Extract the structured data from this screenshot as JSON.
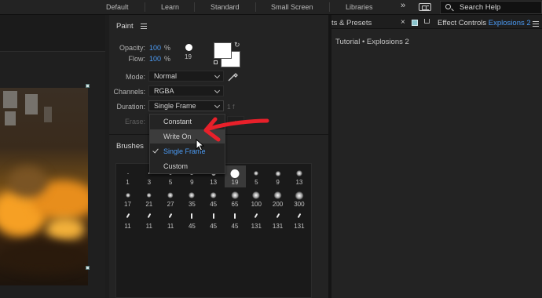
{
  "workspace_bar": {
    "tabs": [
      "Default",
      "Learn",
      "Standard",
      "Small Screen",
      "Libraries"
    ],
    "more_icon": "double-chevron-right",
    "search_placeholder": "Search Help"
  },
  "paint_panel": {
    "title": "Paint",
    "opacity_label": "Opacity:",
    "opacity_value": "100",
    "flow_label": "Flow:",
    "flow_value": "100",
    "percent": "%",
    "brush_size": "19",
    "mode_label": "Mode:",
    "mode_value": "Normal",
    "channels_label": "Channels:",
    "channels_value": "RGBA",
    "duration_label": "Duration:",
    "duration_value": "Single Frame",
    "duration_suffix": "1  f",
    "erase_label": "Erase:",
    "foreground_color": "#ffffff",
    "background_color": "#ffffff"
  },
  "duration_menu": {
    "items": [
      {
        "label": "Constant",
        "state": "normal"
      },
      {
        "label": "Write On",
        "state": "hover"
      },
      {
        "label": "Single Frame",
        "state": "selected"
      },
      {
        "label": "Custom",
        "state": "normal"
      }
    ]
  },
  "brushes_panel": {
    "title": "Brushes",
    "rows": [
      [
        "1",
        "3",
        "5",
        "9",
        "13",
        "19",
        "5",
        "9",
        "13"
      ],
      [
        "17",
        "21",
        "27",
        "35",
        "45",
        "65",
        "100",
        "200",
        "300"
      ],
      [
        "11",
        "11",
        "11",
        "45",
        "45",
        "45",
        "131",
        "131",
        "131"
      ]
    ]
  },
  "right_panel": {
    "tab_effects_presets": "ts & Presets",
    "tab_effect_controls": "Effect Controls",
    "tab_effect_controls_layer": "Explosions 2",
    "subtitle": "Tutorial • Explosions 2"
  },
  "colors": {
    "accent_blue": "#4b9bf5",
    "annotation_red": "#e8202a"
  }
}
